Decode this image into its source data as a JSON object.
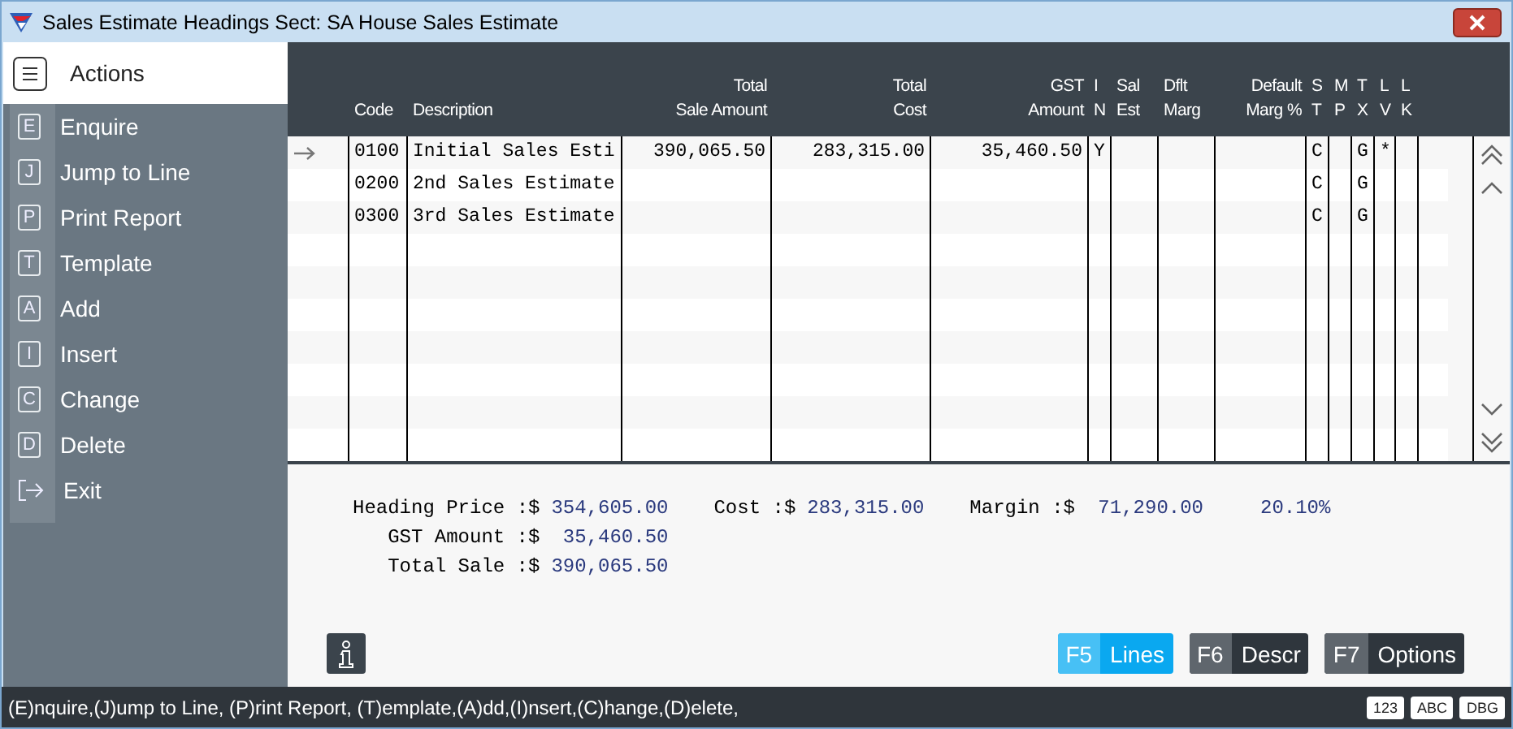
{
  "window": {
    "title": "Sales Estimate Headings  Sect: SA House Sales Estimate"
  },
  "sidebar": {
    "title": "Actions",
    "items": [
      {
        "key": "E",
        "label": "Enquire",
        "kind": "key"
      },
      {
        "key": "J",
        "label": "Jump to Line",
        "kind": "key"
      },
      {
        "key": "P",
        "label": "Print Report",
        "kind": "key"
      },
      {
        "key": "T",
        "label": "Template",
        "kind": "key"
      },
      {
        "key": "A",
        "label": "Add",
        "kind": "key"
      },
      {
        "key": "I",
        "label": "Insert",
        "kind": "key"
      },
      {
        "key": "C",
        "label": "Change",
        "kind": "key"
      },
      {
        "key": "D",
        "label": "Delete",
        "kind": "key"
      },
      {
        "label": "Exit",
        "kind": "exit"
      }
    ]
  },
  "table": {
    "columns": [
      {
        "lines": [
          "Code"
        ]
      },
      {
        "lines": [
          "Description"
        ]
      },
      {
        "lines": [
          "Total",
          "Sale Amount"
        ]
      },
      {
        "lines": [
          "Total",
          "Cost"
        ]
      },
      {
        "lines": [
          "GST",
          "Amount"
        ]
      },
      {
        "lines": [
          "I",
          "N"
        ]
      },
      {
        "lines": [
          "Sal",
          "Est"
        ]
      },
      {
        "lines": [
          "Dflt",
          "Marg"
        ]
      },
      {
        "lines": [
          "Default",
          "Marg %"
        ]
      },
      {
        "lines": [
          "S",
          "T"
        ]
      },
      {
        "lines": [
          "M",
          "P"
        ]
      },
      {
        "lines": [
          "T",
          "X"
        ]
      },
      {
        "lines": [
          "L",
          "V"
        ]
      },
      {
        "lines": [
          "L",
          "K"
        ]
      }
    ],
    "rows": [
      {
        "current": true,
        "cells": [
          "0100",
          "Initial Sales Esti",
          "390,065.50",
          "283,315.00",
          "35,460.50",
          "Y",
          "",
          "",
          "",
          "C",
          "",
          "G",
          "*",
          ""
        ]
      },
      {
        "current": false,
        "cells": [
          "0200",
          "2nd Sales Estimate",
          "",
          "",
          "",
          "",
          "",
          "",
          "",
          "C",
          "",
          "G",
          "",
          ""
        ]
      },
      {
        "current": false,
        "cells": [
          "0300",
          "3rd Sales Estimate",
          "",
          "",
          "",
          "",
          "",
          "",
          "",
          "C",
          "",
          "G",
          "",
          ""
        ]
      }
    ]
  },
  "summary": [
    [
      {
        "label": "Heading Price :$",
        "value": "354,605.00"
      },
      {
        "label": "Cost :$",
        "value": "283,315.00"
      },
      {
        "label": "Margin :$",
        "value": " 71,290.00"
      },
      {
        "value": "20.10%"
      }
    ],
    [
      {
        "label": "GST Amount :$",
        "value": " 35,460.50"
      }
    ],
    [
      {
        "label": "Total Sale :$",
        "value": "390,065.50"
      }
    ]
  ],
  "buttons": [
    {
      "key": "F5",
      "label": "Lines",
      "selected": true
    },
    {
      "key": "F6",
      "label": "Descr",
      "selected": false
    },
    {
      "key": "F7",
      "label": "Options",
      "selected": false
    }
  ],
  "status_bar": {
    "text": "(E)nquire,(J)ump to Line, (P)rint Report, (T)emplate,(A)dd,(I)nsert,(C)hange,(D)elete,",
    "badges": [
      "123",
      "ABC",
      "DBG"
    ]
  }
}
